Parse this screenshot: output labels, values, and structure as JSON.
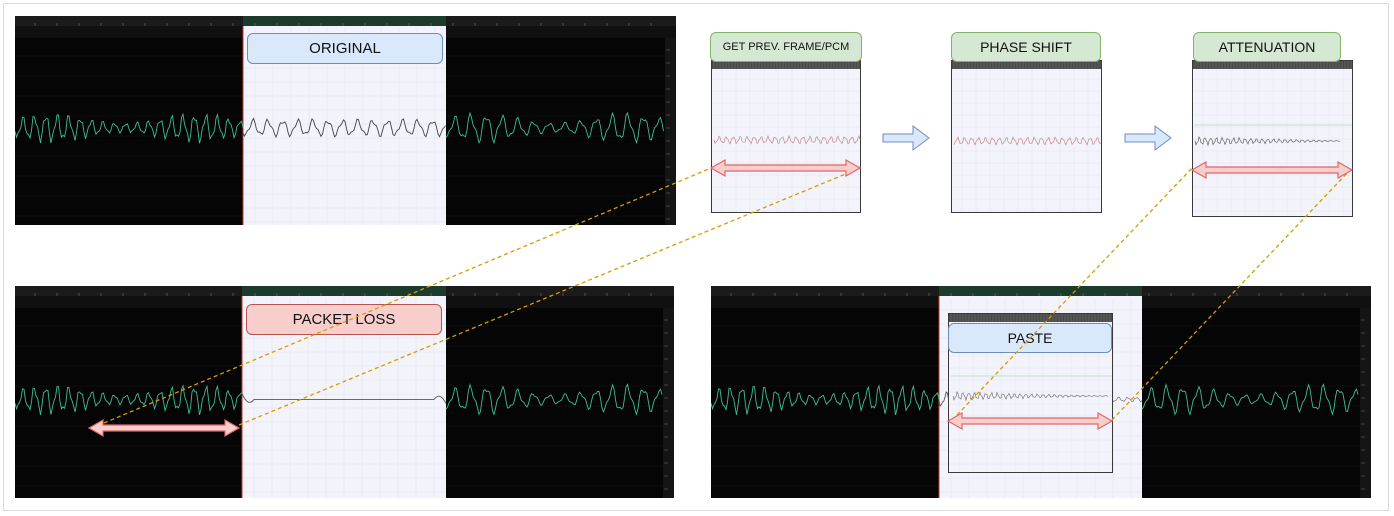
{
  "labels": {
    "original": "ORIGINAL",
    "packet_loss": "PACKET LOSS",
    "get_prev_frame": "GET PREV. FRAME/PCM",
    "phase_shift": "PHASE SHIFT",
    "attenuation": "ATTENUATION",
    "paste": "PASTE"
  },
  "colors": {
    "waveform_green": "#3fbf8f",
    "highlight_bg": "#f3f3fb",
    "arrow_red_fill": "#f8cecc",
    "arrow_red_stroke": "#e06666",
    "flow_arrow_fill": "#dae8fc",
    "flow_arrow_stroke": "#6c8ebf",
    "connector_dashed": "#d79b00",
    "label_blue": "#dae8fc",
    "label_red": "#f8cecc",
    "label_green": "#d5e8d4"
  },
  "icons": [
    "double-headed-arrow",
    "right-arrow",
    "dashed-connector"
  ]
}
